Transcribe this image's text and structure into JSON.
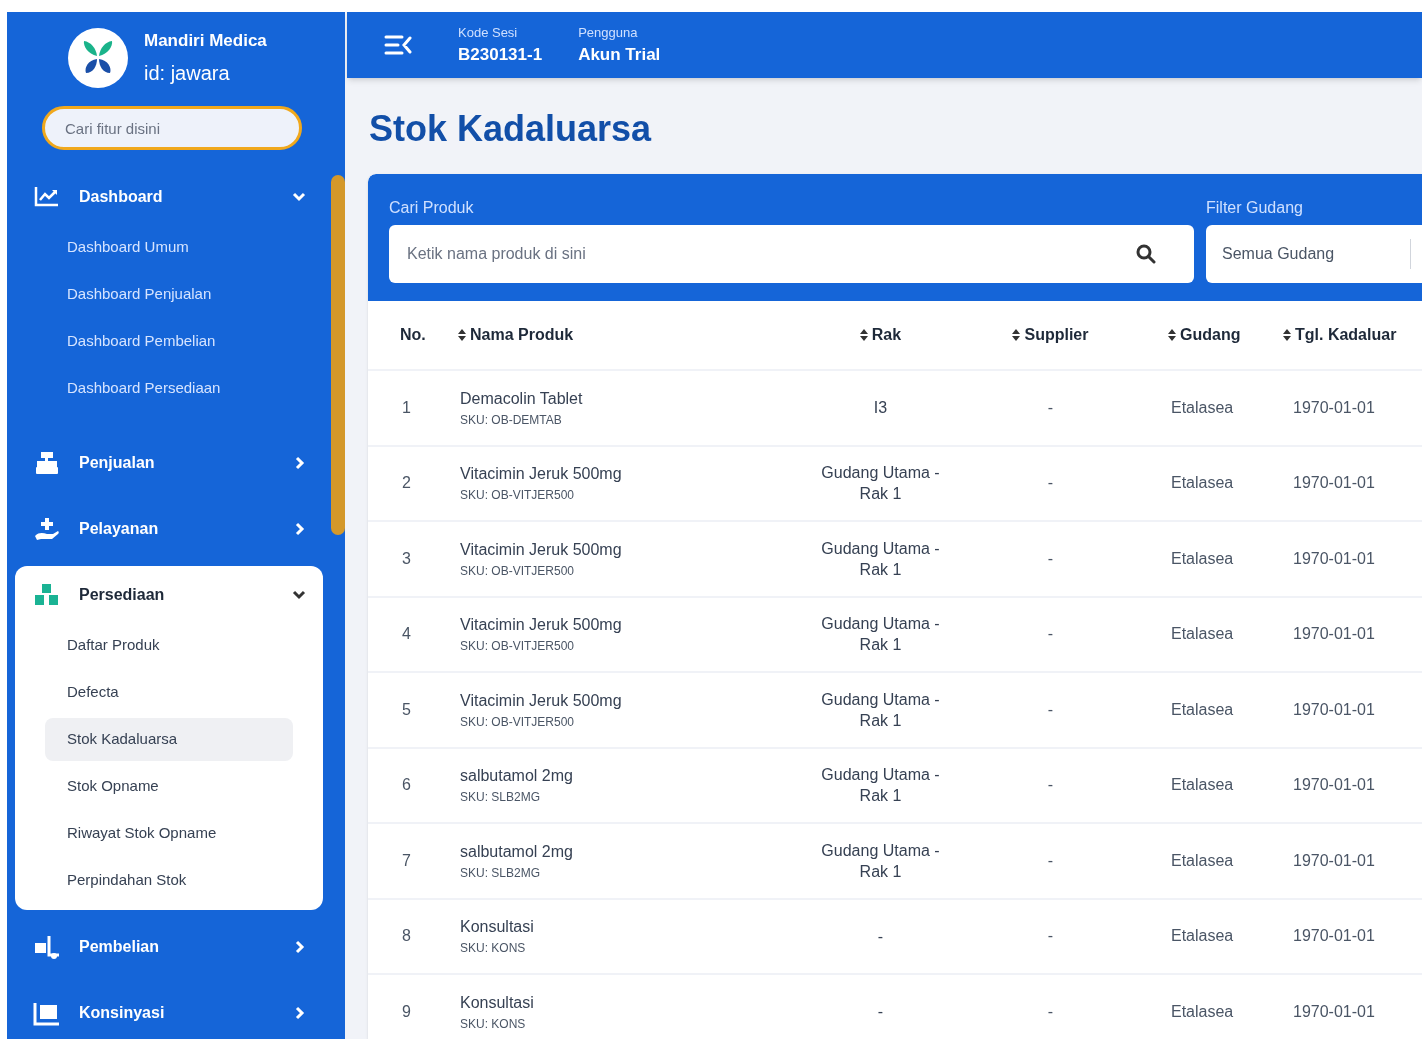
{
  "brand": {
    "name": "Mandiri Medica",
    "id": "id: jawara"
  },
  "sidebar": {
    "search": {
      "placeholder": "Cari fitur disini"
    },
    "menu": [
      {
        "label": "Dashboard",
        "expanded": true,
        "active": false,
        "children": [
          {
            "label": "Dashboard Umum",
            "selected": false
          },
          {
            "label": "Dashboard Penjualan",
            "selected": false
          },
          {
            "label": "Dashboard Pembelian",
            "selected": false
          },
          {
            "label": "Dashboard Persediaan",
            "selected": false
          }
        ]
      },
      {
        "label": "Penjualan",
        "expanded": false,
        "active": false
      },
      {
        "label": "Pelayanan",
        "expanded": false,
        "active": false
      },
      {
        "label": "Persediaan",
        "expanded": true,
        "active": true,
        "children": [
          {
            "label": "Daftar Produk",
            "selected": false
          },
          {
            "label": "Defecta",
            "selected": false
          },
          {
            "label": "Stok Kadaluarsa",
            "selected": true
          },
          {
            "label": "Stok Opname",
            "selected": false
          },
          {
            "label": "Riwayat Stok Opname",
            "selected": false
          },
          {
            "label": "Perpindahan Stok",
            "selected": false
          }
        ]
      },
      {
        "label": "Pembelian",
        "expanded": false,
        "active": false
      },
      {
        "label": "Konsinyasi",
        "expanded": false,
        "active": false
      }
    ]
  },
  "header": {
    "fields": [
      {
        "label": "Kode Sesi",
        "value": "B230131-1"
      },
      {
        "label": "Pengguna",
        "value": "Akun Trial"
      }
    ]
  },
  "page_title": "Stok Kadaluarsa",
  "filters": {
    "product_search": {
      "label": "Cari Produk",
      "placeholder": "Ketik nama produk di sini"
    },
    "warehouse": {
      "label": "Filter Gudang",
      "value": "Semua Gudang"
    }
  },
  "table": {
    "columns": [
      {
        "label": "No.",
        "sortable": false
      },
      {
        "label": "Nama Produk",
        "sortable": true
      },
      {
        "label": "Rak",
        "sortable": true
      },
      {
        "label": "Supplier",
        "sortable": true
      },
      {
        "label": "Gudang",
        "sortable": true
      },
      {
        "label": "Tgl. Kadaluar",
        "sortable": true
      }
    ],
    "rows": [
      {
        "no": "1",
        "name": "Demacolin Tablet",
        "sku": "SKU: OB-DEMTAB",
        "rak": "I3",
        "supplier": "-",
        "gudang": "Etalasea",
        "date": "1970-01-01"
      },
      {
        "no": "2",
        "name": "Vitacimin Jeruk 500mg",
        "sku": "SKU: OB-VITJER500",
        "rak": "Gudang Utama - Rak 1",
        "supplier": "-",
        "gudang": "Etalasea",
        "date": "1970-01-01"
      },
      {
        "no": "3",
        "name": "Vitacimin Jeruk 500mg",
        "sku": "SKU: OB-VITJER500",
        "rak": "Gudang Utama - Rak 1",
        "supplier": "-",
        "gudang": "Etalasea",
        "date": "1970-01-01"
      },
      {
        "no": "4",
        "name": "Vitacimin Jeruk 500mg",
        "sku": "SKU: OB-VITJER500",
        "rak": "Gudang Utama - Rak 1",
        "supplier": "-",
        "gudang": "Etalasea",
        "date": "1970-01-01"
      },
      {
        "no": "5",
        "name": "Vitacimin Jeruk 500mg",
        "sku": "SKU: OB-VITJER500",
        "rak": "Gudang Utama - Rak 1",
        "supplier": "-",
        "gudang": "Etalasea",
        "date": "1970-01-01"
      },
      {
        "no": "6",
        "name": "salbutamol 2mg",
        "sku": "SKU: SLB2MG",
        "rak": "Gudang Utama - Rak 1",
        "supplier": "-",
        "gudang": "Etalasea",
        "date": "1970-01-01"
      },
      {
        "no": "7",
        "name": "salbutamol 2mg",
        "sku": "SKU: SLB2MG",
        "rak": "Gudang Utama - Rak 1",
        "supplier": "-",
        "gudang": "Etalasea",
        "date": "1970-01-01"
      },
      {
        "no": "8",
        "name": "Konsultasi",
        "sku": "SKU: KONS",
        "rak": "-",
        "supplier": "-",
        "gudang": "Etalasea",
        "date": "1970-01-01"
      },
      {
        "no": "9",
        "name": "Konsultasi",
        "sku": "SKU: KONS",
        "rak": "-",
        "supplier": "-",
        "gudang": "Etalasea",
        "date": "1970-01-01"
      }
    ]
  }
}
